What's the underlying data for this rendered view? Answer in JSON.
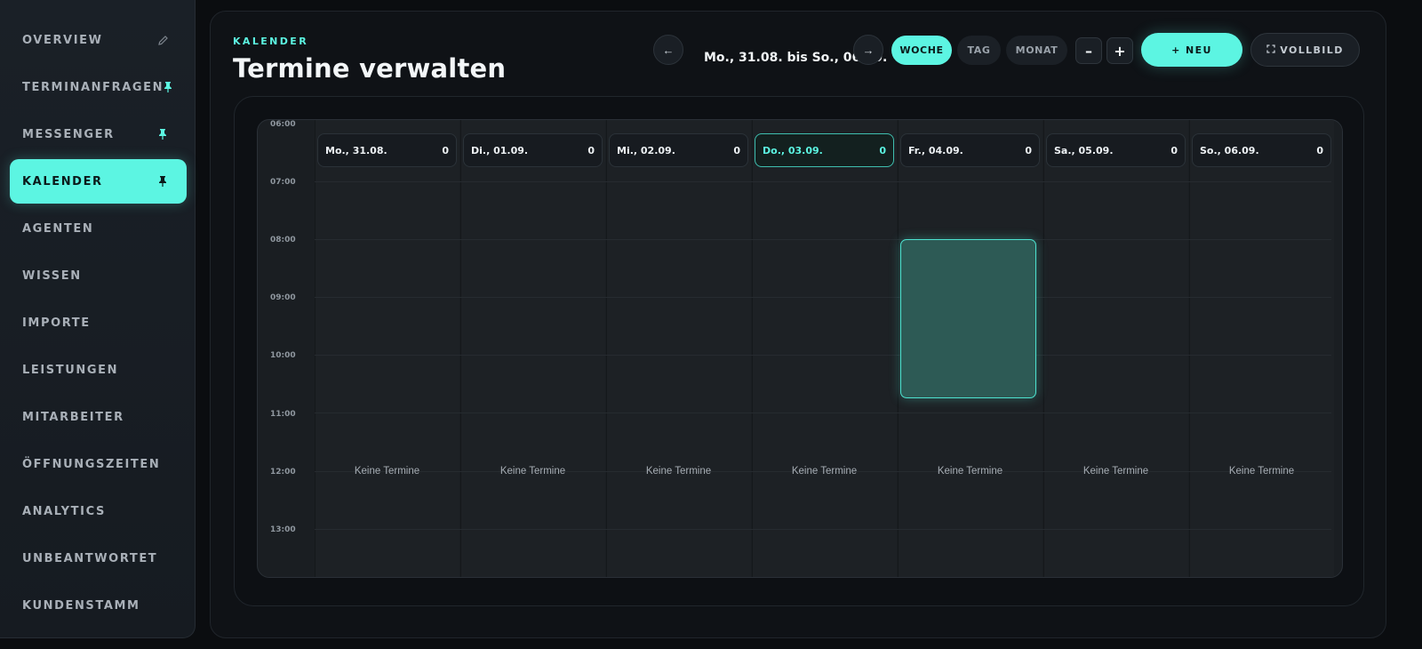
{
  "sidebar": {
    "items": [
      {
        "label": "OVERVIEW",
        "icon": "pencil-icon",
        "active": false
      },
      {
        "label": "TERMINANFRAGEN",
        "icon": "pin-icon",
        "active": false
      },
      {
        "label": "MESSENGER",
        "icon": "pin-icon",
        "active": false
      },
      {
        "label": "KALENDER",
        "icon": "pin-icon",
        "active": true
      },
      {
        "label": "AGENTEN",
        "icon": "",
        "active": false
      },
      {
        "label": "WISSEN",
        "icon": "",
        "active": false
      },
      {
        "label": "IMPORTE",
        "icon": "",
        "active": false
      },
      {
        "label": "LEISTUNGEN",
        "icon": "",
        "active": false
      },
      {
        "label": "MITARBEITER",
        "icon": "",
        "active": false
      },
      {
        "label": "ÖFFNUNGSZEITEN",
        "icon": "",
        "active": false
      },
      {
        "label": "ANALYTICS",
        "icon": "",
        "active": false
      },
      {
        "label": "UNBEANTWORTET",
        "icon": "",
        "active": false
      },
      {
        "label": "KUNDENSTAMM",
        "icon": "",
        "active": false
      }
    ]
  },
  "header": {
    "breadcrumb": "KALENDER",
    "title": "Termine verwalten"
  },
  "toolbar": {
    "prev_label": "←",
    "next_label": "→",
    "range": "Mo., 31.08. bis So., 06.09.",
    "views": [
      {
        "label": "WOCHE",
        "active": true
      },
      {
        "label": "TAG",
        "active": false
      },
      {
        "label": "MONAT",
        "active": false
      }
    ],
    "zoom_out_label": "–",
    "zoom_in_label": "+",
    "new_label": "+ NEU",
    "fullscreen_label": "VOLLBILD"
  },
  "calendar": {
    "hours": [
      "06:00",
      "07:00",
      "08:00",
      "09:00",
      "10:00",
      "11:00",
      "12:00",
      "13:00"
    ],
    "days": [
      {
        "label": "Mo., 31.08.",
        "count": "0",
        "today": false,
        "empty_text": "Keine Termine"
      },
      {
        "label": "Di., 01.09.",
        "count": "0",
        "today": false,
        "empty_text": "Keine Termine"
      },
      {
        "label": "Mi., 02.09.",
        "count": "0",
        "today": false,
        "empty_text": "Keine Termine"
      },
      {
        "label": "Do., 03.09.",
        "count": "0",
        "today": true,
        "empty_text": "Keine Termine"
      },
      {
        "label": "Fr., 04.09.",
        "count": "0",
        "today": false,
        "empty_text": "Keine Termine"
      },
      {
        "label": "Sa., 05.09.",
        "count": "0",
        "today": false,
        "empty_text": "Keine Termine"
      },
      {
        "label": "So., 06.09.",
        "count": "0",
        "today": false,
        "empty_text": "Keine Termine"
      }
    ],
    "selection": {
      "day": "Fr., 04.09.",
      "start": "08:00",
      "end": "10:45"
    }
  },
  "colors": {
    "accent": "#5cf5e2",
    "background": "#0b0d10",
    "panel": "#0f1216",
    "selection_fill": "#2d5a55"
  }
}
